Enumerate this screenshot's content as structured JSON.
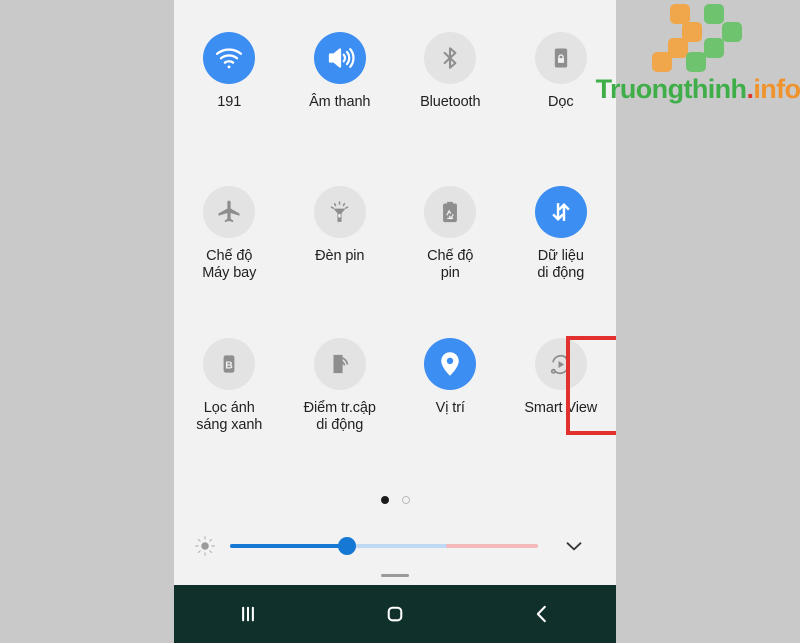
{
  "watermark": {
    "text_part_1": "Truongthinh",
    "text_dot": ".",
    "text_part_2": "info",
    "logo_name": "truongthinh-logo",
    "green": "#3fae49",
    "orange": "#f0932c",
    "red": "#e0392c"
  },
  "panel": {
    "background": "#f2f2f2",
    "page_background": "#c9c9c9"
  },
  "quick_settings": {
    "accent_on": "#3d8ef2",
    "circle_off": "#e3e3e3",
    "rows": [
      {
        "tiles": [
          {
            "label": "191",
            "icon": "wifi-icon",
            "state": "on"
          },
          {
            "label": "Âm thanh",
            "icon": "sound-icon",
            "state": "on"
          },
          {
            "label": "Bluetooth",
            "icon": "bluetooth-icon",
            "state": "off"
          },
          {
            "label": "Dọc",
            "icon": "rotation-lock-icon",
            "state": "off"
          }
        ]
      },
      {
        "tiles": [
          {
            "label": "Chế độ\nMáy bay",
            "icon": "airplane-icon",
            "state": "off"
          },
          {
            "label": "Đèn pin",
            "icon": "flashlight-icon",
            "state": "off"
          },
          {
            "label": "Chế độ\npin",
            "icon": "power-saving-icon",
            "state": "off"
          },
          {
            "label": "Dữ liệu\ndi động",
            "icon": "mobile-data-icon",
            "state": "on"
          }
        ]
      },
      {
        "tiles": [
          {
            "label": "Lọc ánh\nsáng xanh",
            "icon": "blue-light-filter-icon",
            "state": "off"
          },
          {
            "label": "Điểm tr.cập\ndi động",
            "icon": "mobile-hotspot-icon",
            "state": "off"
          },
          {
            "label": "Vị trí",
            "icon": "location-icon",
            "state": "on"
          },
          {
            "label": "Smart View",
            "icon": "smart-view-icon",
            "state": "off"
          }
        ]
      }
    ]
  },
  "highlight": {
    "name": "vi-tri-highlight-box",
    "color": "#e2302f",
    "target_label": "Vị trí"
  },
  "pagination": {
    "total_pages": 2,
    "current_page": 1
  },
  "brightness": {
    "icon": "brightness-icon",
    "value_percent": 38,
    "expand_icon": "chevron-down-icon",
    "track_color": "#1478d4",
    "warm_color": "#f4b9bb"
  },
  "nav_bar": {
    "background": "#10302b",
    "buttons": [
      {
        "name": "recents-button",
        "icon": "recents-icon"
      },
      {
        "name": "home-button",
        "icon": "home-icon"
      },
      {
        "name": "back-button",
        "icon": "back-icon"
      }
    ]
  }
}
